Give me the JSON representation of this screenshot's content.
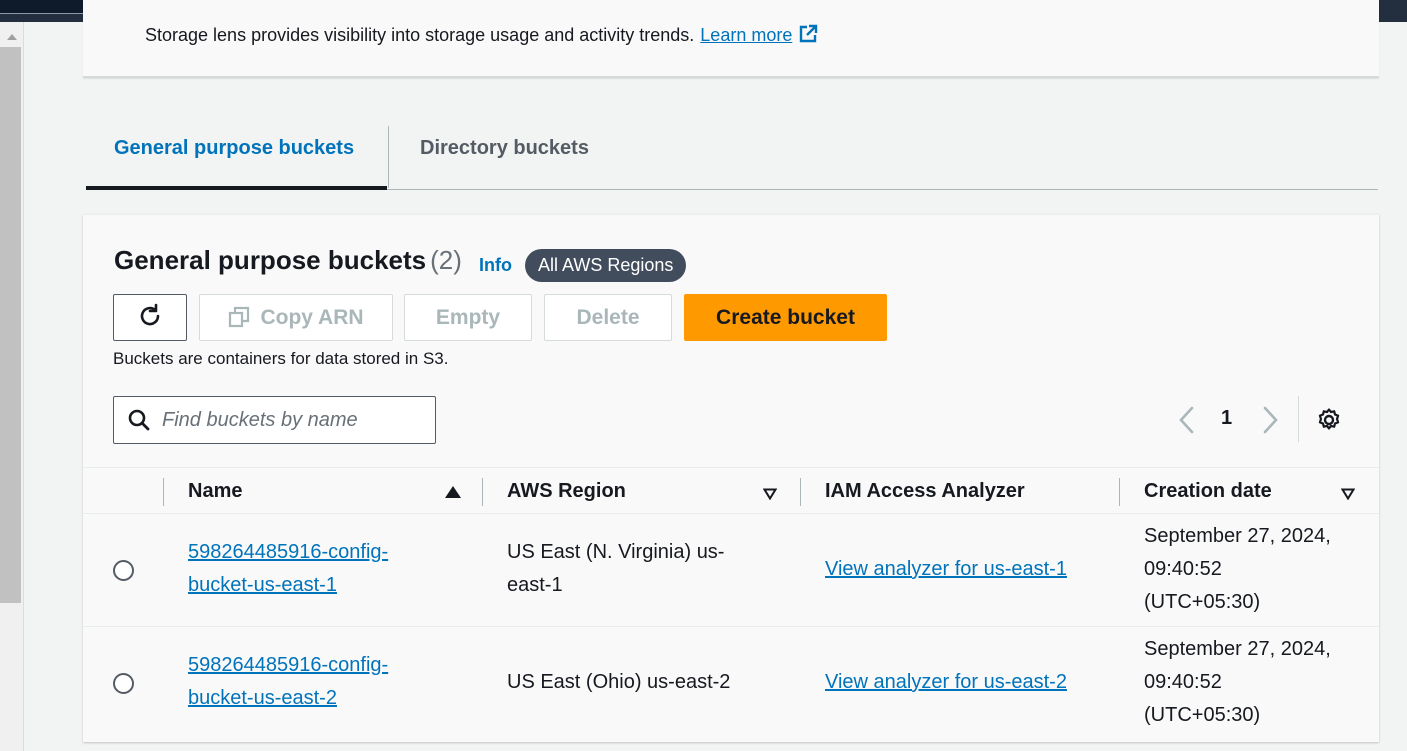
{
  "storage_lens": {
    "description": "Storage lens provides visibility into storage usage and activity trends.",
    "learn_more": "Learn more"
  },
  "tabs": [
    {
      "label": "General purpose buckets",
      "active": true
    },
    {
      "label": "Directory buckets",
      "active": false
    }
  ],
  "panel": {
    "title": "General purpose buckets",
    "count": "(2)",
    "info": "Info",
    "region_badge": "All AWS Regions",
    "helper_text": "Buckets are containers for data stored in S3."
  },
  "toolbar": {
    "copy_arn": "Copy ARN",
    "empty": "Empty",
    "delete": "Delete",
    "create_bucket": "Create bucket"
  },
  "search": {
    "placeholder": "Find buckets by name",
    "value": ""
  },
  "pagination": {
    "current_page": "1"
  },
  "table": {
    "columns": [
      "Name",
      "AWS Region",
      "IAM Access Analyzer",
      "Creation date"
    ],
    "rows": [
      {
        "name_line1": "598264485916-config-",
        "name_line2": "bucket-us-east-1",
        "region_line1": "US East (N. Virginia) us-",
        "region_line2": "east-1",
        "analyzer": "View analyzer for us-east-1",
        "date_line1": "September 27, 2024,",
        "date_line2": "09:40:52",
        "date_line3": "(UTC+05:30)"
      },
      {
        "name_line1": "598264485916-config-",
        "name_line2": "bucket-us-east-2",
        "region": "US East (Ohio) us-east-2",
        "analyzer": "View analyzer for us-east-2",
        "date_line1": "September 27, 2024,",
        "date_line2": "09:40:52",
        "date_line3": "(UTC+05:30)"
      }
    ]
  },
  "colors": {
    "link": "#0073bb",
    "primary_button": "#ff9900",
    "top_bar": "#232f3e",
    "badge": "#414d5c"
  },
  "icons": [
    "external-link-icon",
    "refresh-icon",
    "copy-icon",
    "search-icon",
    "chevron-left-icon",
    "chevron-right-icon",
    "settings-gear-icon",
    "sort-ascending-icon",
    "sort-descending-icon"
  ]
}
